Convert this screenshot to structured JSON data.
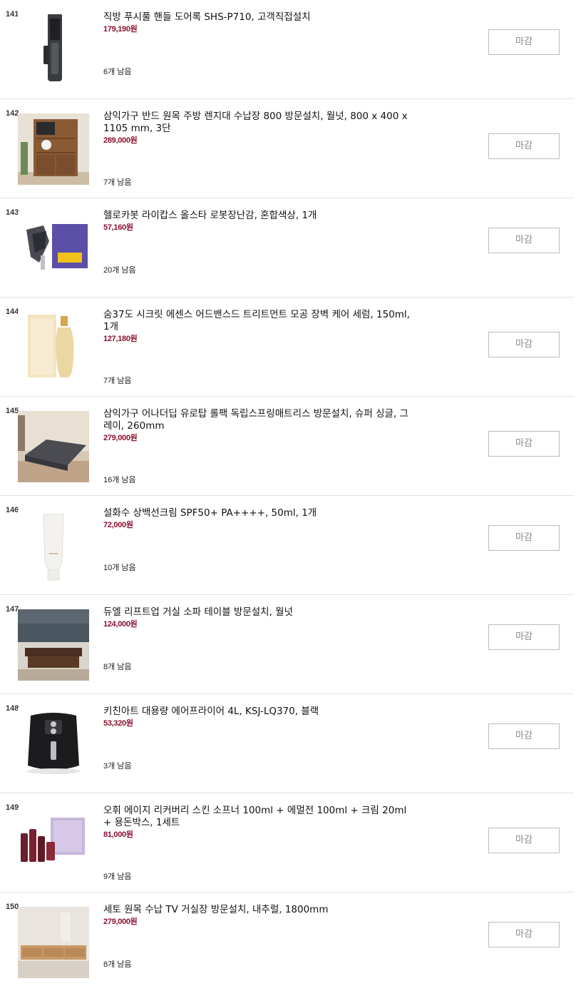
{
  "items": [
    {
      "rank": "141",
      "title": "직방 푸시풀 핸들 도어록 SHS-P710, 고객직접설치",
      "price": "179,190원",
      "stock": "6개 남음",
      "button": "마감",
      "image": "door-lock"
    },
    {
      "rank": "142",
      "title": "삼익가구 반드 원목 주방 렌지대 수납장 800 방문설치, 월넛, 800 x 400 x 1105 mm, 3단",
      "price": "289,000원",
      "stock": "7개 남음",
      "button": "마감",
      "image": "kitchen-cabinet"
    },
    {
      "rank": "143",
      "title": "헬로카봇 라이캅스 올스타 로봇장난감, 혼합색상, 1개",
      "price": "57,160원",
      "stock": "20개 남음",
      "button": "마감",
      "image": "robot-toy"
    },
    {
      "rank": "144",
      "title": "숨37도 시크릿 에센스 어드밴스드 트리트먼트 모공 장벽 케어 세럼, 150ml, 1개",
      "price": "127,180원",
      "stock": "7개 남음",
      "button": "마감",
      "image": "essence-bottle"
    },
    {
      "rank": "145",
      "title": "삼익가구 어나더딥 유로탑 롤팩 독립스프링매트리스 방문설치, 슈퍼 싱글, 그레이, 260mm",
      "price": "279,000원",
      "stock": "16개 남음",
      "button": "마감",
      "image": "mattress"
    },
    {
      "rank": "146",
      "title": "설화수 상백선크림 SPF50+ PA++++, 50ml, 1개",
      "price": "72,000원",
      "stock": "10개 남음",
      "button": "마감",
      "image": "sun-cream"
    },
    {
      "rank": "147",
      "title": "듀엘 리프트업 거실 소파 테이블 방문설치, 월넛",
      "price": "124,000원",
      "stock": "8개 남음",
      "button": "마감",
      "image": "sofa-table"
    },
    {
      "rank": "148",
      "title": "키친아트 대용량 에어프라이어 4L, KSJ-LQ370, 블랙",
      "price": "53,320원",
      "stock": "3개 남음",
      "button": "마감",
      "image": "air-fryer"
    },
    {
      "rank": "149",
      "title": "오휘 에이지 리커버리 스킨 소프너 100ml + 에멀전 100ml + 크림 20ml + 용돈박스, 1세트",
      "price": "81,000원",
      "stock": "9개 남음",
      "button": "마감",
      "image": "skincare-set"
    },
    {
      "rank": "150",
      "title": "세토 원목 수납 TV 거실장 방문설치, 내추럴, 1800mm",
      "price": "279,000원",
      "stock": "8개 남음",
      "button": "마감",
      "image": "tv-stand"
    }
  ]
}
